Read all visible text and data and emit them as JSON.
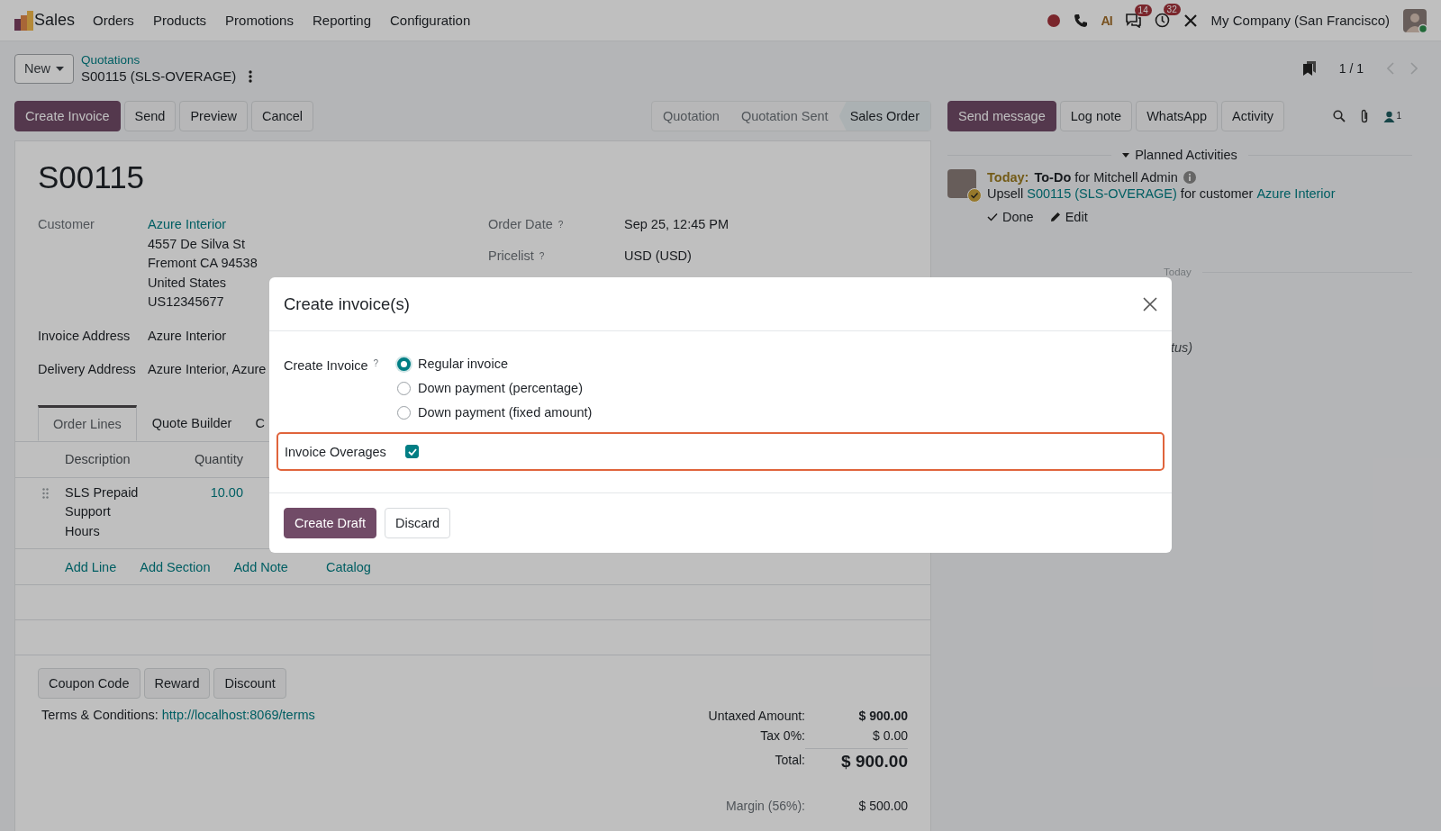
{
  "top_nav": {
    "app": "Sales",
    "menu": [
      "Orders",
      "Products",
      "Promotions",
      "Reporting",
      "Configuration"
    ],
    "ai_label": "AI",
    "chat_badge": "14",
    "activity_badge": "32",
    "company": "My Company (San Francisco)"
  },
  "control_panel": {
    "new_button": "New",
    "breadcrumb": "Quotations",
    "record_title": "S00115 (SLS-OVERAGE)",
    "pager": "1 / 1"
  },
  "action_buttons": [
    {
      "label": "Create Invoice",
      "primary": true
    },
    {
      "label": "Send",
      "primary": false
    },
    {
      "label": "Preview",
      "primary": false
    },
    {
      "label": "Cancel",
      "primary": false
    }
  ],
  "status_steps": [
    {
      "label": "Quotation",
      "selected": false
    },
    {
      "label": "Quotation Sent",
      "selected": false
    },
    {
      "label": "Sales Order",
      "selected": true
    }
  ],
  "chatter_buttons": [
    {
      "label": "Send message",
      "primary": true
    },
    {
      "label": "Log note",
      "primary": false
    },
    {
      "label": "WhatsApp",
      "primary": false
    },
    {
      "label": "Activity",
      "primary": false
    }
  ],
  "followers_count": "1",
  "form": {
    "title": "S00115",
    "left_fields": [
      {
        "label": "Customer",
        "link": "Azure Interior",
        "lines": [
          "4557 De Silva St",
          "Fremont CA 94538",
          "United States",
          "US12345677"
        ]
      },
      {
        "label": "Invoice Address",
        "lines": [
          "Azure Interior"
        ]
      },
      {
        "label": "Delivery Address",
        "lines": [
          "Azure Interior, Azure"
        ]
      }
    ],
    "right_fields": [
      {
        "label": "Order Date",
        "help": "?",
        "value": "Sep 25, 12:45 PM"
      },
      {
        "label": "Pricelist",
        "help": "?",
        "value": "USD (USD)"
      }
    ],
    "tabs": [
      {
        "label": "Order Lines",
        "selected": true
      },
      {
        "label": "Quote Builder",
        "selected": false
      },
      {
        "label": "C",
        "selected": false
      }
    ],
    "table": {
      "columns": [
        "Description",
        "Quantity"
      ],
      "rows": [
        {
          "description": "SLS Prepaid Support Hours",
          "quantity": "10.00"
        }
      ]
    },
    "add_links": [
      "Add Line",
      "Add Section",
      "Add Note",
      "Catalog"
    ],
    "footer_buttons": [
      "Coupon Code",
      "Reward",
      "Discount"
    ],
    "terms": {
      "label": "Terms & Conditions:",
      "link": "http://localhost:8069/terms"
    },
    "totals": [
      {
        "label": "Untaxed Amount:",
        "value": "$ 900.00",
        "kind": "subtotal"
      },
      {
        "label": "Tax 0%:",
        "value": "$ 0.00",
        "kind": "tax"
      },
      {
        "label": "Total:",
        "value": "$ 900.00",
        "kind": "total"
      }
    ],
    "margin": {
      "label": "Margin (56%):",
      "value": "$ 500.00"
    }
  },
  "chatter": {
    "section": "Planned Activities",
    "activity": {
      "due": "Today:",
      "heading": "**To-Do** for Mitchell Admin",
      "summary": [
        {
          "text": "Upsell",
          "link": false
        },
        {
          "text": "S00115 (SLS-OVERAGE)",
          "link": true
        },
        {
          "text": "for customer",
          "link": false
        },
        {
          "text": "Azure Interior",
          "link": true
        }
      ],
      "actions": [
        "Done",
        "Edit"
      ]
    },
    "date_divider": "Today",
    "partial_message": "tus)"
  },
  "dialog": {
    "title": "Create invoice(s)",
    "field_label": "Create Invoice",
    "help": "?",
    "options": [
      {
        "label": "Regular invoice",
        "selected": true
      },
      {
        "label": "Down payment (percentage)",
        "selected": false
      },
      {
        "label": "Down payment (fixed amount)",
        "selected": false
      }
    ],
    "overages": {
      "label": "Invoice Overages",
      "checked": true,
      "highlighted": true
    },
    "buttons": [
      {
        "label": "Create Draft",
        "primary": true
      },
      {
        "label": "Discard",
        "primary": false
      }
    ]
  }
}
